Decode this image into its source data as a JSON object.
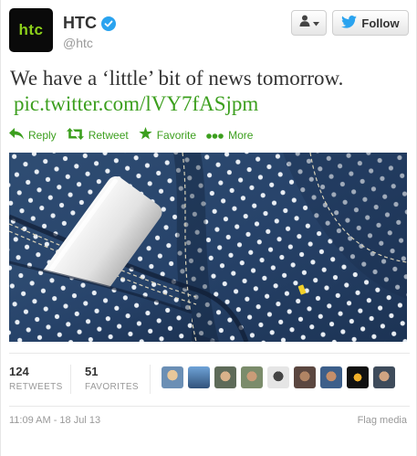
{
  "user": {
    "avatar_text": "htc",
    "fullname": "HTC",
    "screenname": "@htc",
    "verified": true
  },
  "header_buttons": {
    "follow_label": "Follow",
    "user_dropdown_icon": "person-icon"
  },
  "tweet": {
    "text": "We have a ‘little’ bit of news tomorrow.",
    "link": "pic.twitter.com/lVY7fASjpm"
  },
  "actions": [
    {
      "icon": "reply-icon",
      "label": "Reply"
    },
    {
      "icon": "retweet-icon",
      "label": "Retweet"
    },
    {
      "icon": "star-icon",
      "label": "Favorite"
    },
    {
      "icon": "more-dots-icon",
      "label": "More"
    }
  ],
  "stats": {
    "retweets_count": "124",
    "retweets_label": "RETWEETS",
    "favorites_count": "51",
    "favorites_label": "FAVORITES"
  },
  "footer": {
    "timestamp": "11:09 AM - 18 Jul 13",
    "flag_media": "Flag media"
  },
  "colors": {
    "accent_green": "#3c9f1e",
    "verified_blue": "#2aa3ef",
    "twitter_blue": "#2aa3ef"
  }
}
